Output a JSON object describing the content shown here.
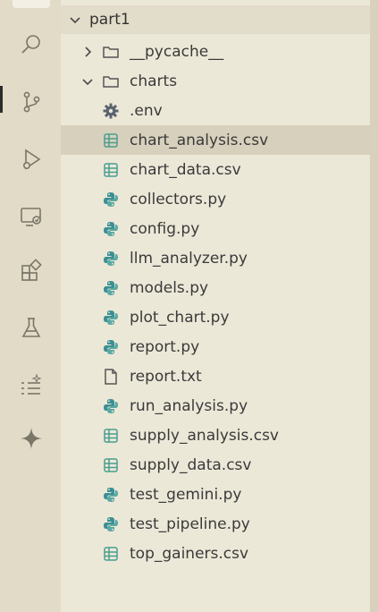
{
  "explorer": {
    "root": {
      "label": "part1",
      "expanded": true
    },
    "items": [
      {
        "label": "__pycache__",
        "kind": "folder",
        "expanded": false,
        "icon": "folder-icon"
      },
      {
        "label": "charts",
        "kind": "folder",
        "expanded": true,
        "icon": "folder-icon"
      },
      {
        "label": ".env",
        "kind": "file",
        "icon": "gear-icon"
      },
      {
        "label": "chart_analysis.csv",
        "kind": "file",
        "icon": "csv-icon",
        "selected": true
      },
      {
        "label": "chart_data.csv",
        "kind": "file",
        "icon": "csv-icon"
      },
      {
        "label": "collectors.py",
        "kind": "file",
        "icon": "python-icon"
      },
      {
        "label": "config.py",
        "kind": "file",
        "icon": "python-icon"
      },
      {
        "label": "llm_analyzer.py",
        "kind": "file",
        "icon": "python-icon"
      },
      {
        "label": "models.py",
        "kind": "file",
        "icon": "python-icon"
      },
      {
        "label": "plot_chart.py",
        "kind": "file",
        "icon": "python-icon"
      },
      {
        "label": "report.py",
        "kind": "file",
        "icon": "python-icon"
      },
      {
        "label": "report.txt",
        "kind": "file",
        "icon": "text-file-icon"
      },
      {
        "label": "run_analysis.py",
        "kind": "file",
        "icon": "python-icon"
      },
      {
        "label": "supply_analysis.csv",
        "kind": "file",
        "icon": "csv-icon"
      },
      {
        "label": "supply_data.csv",
        "kind": "file",
        "icon": "csv-icon"
      },
      {
        "label": "test_gemini.py",
        "kind": "file",
        "icon": "python-icon"
      },
      {
        "label": "test_pipeline.py",
        "kind": "file",
        "icon": "python-icon"
      },
      {
        "label": "top_gainers.csv",
        "kind": "file",
        "icon": "csv-icon"
      }
    ]
  },
  "activity_bar": {
    "icons": [
      "search-icon",
      "source-control-icon",
      "run-debug-icon",
      "remote-explorer-icon",
      "extensions-icon",
      "testing-icon",
      "task-list-icon",
      "sparkle-icon"
    ]
  },
  "colors": {
    "accent_icon": "#4a9e8f",
    "python_icon": "#3c8f94",
    "selected_bg": "#d7d0bc"
  }
}
